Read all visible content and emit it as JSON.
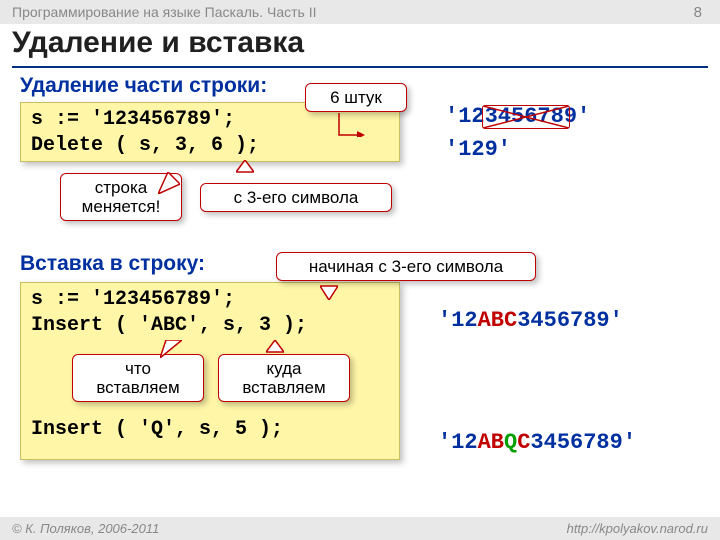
{
  "header": {
    "course": "Программирование на языке Паскаль. Часть II",
    "page": "8"
  },
  "title": "Удаление и вставка",
  "section1": {
    "heading": "Удаление части строки:"
  },
  "code1": {
    "l1": "s := '123456789';",
    "l2": "Delete ( s, 3, 6 );"
  },
  "callouts": {
    "six": "6 штук",
    "changes": "строка\nменяется!",
    "from3": "с 3-его символа",
    "startFrom3": "начиная с 3-его символа",
    "what": "что\nвставляем",
    "where": "куда\nвставляем"
  },
  "out": {
    "orig": "'123456789'",
    "afterDel": "'129'",
    "ins1_a": "'12",
    "ins1_b": "ABC",
    "ins1_c": "3456789'",
    "ins2_a": "'12",
    "ins2_b": "AB",
    "ins2_q": "Q",
    "ins2_c": "C",
    "ins2_d": "3456789'"
  },
  "section2": {
    "heading": "Вставка в строку:"
  },
  "code2": {
    "l1": "s := '123456789';",
    "l2": "Insert ( 'ABC', s, 3 );",
    "l3": "Insert ( 'Q', s, 5 );"
  },
  "footer": {
    "left": "© К. Поляков, 2006-2011",
    "right": "http://kpolyakov.narod.ru"
  }
}
